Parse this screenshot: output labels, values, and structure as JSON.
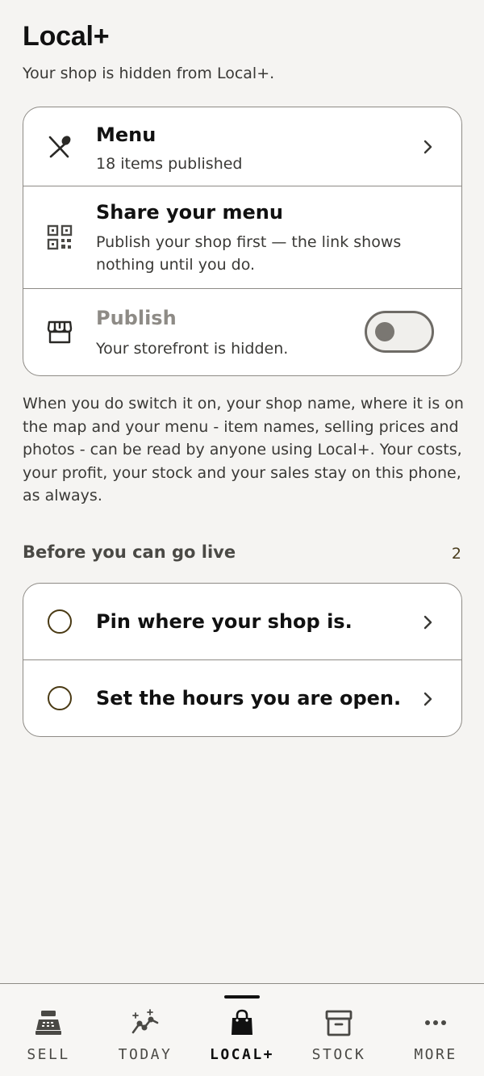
{
  "header": {
    "title": "Local+",
    "subtitle": "Your shop is hidden from Local+."
  },
  "settings": {
    "menu": {
      "title": "Menu",
      "subtitle": "18 items published",
      "icon": "utensils-icon"
    },
    "share": {
      "title": "Share your menu",
      "subtitle": "Publish your shop first — the link shows nothing until you do.",
      "icon": "qr-code-icon"
    },
    "publish": {
      "title": "Publish",
      "subtitle": "Your storefront is hidden.",
      "icon": "storefront-icon",
      "enabled": false
    }
  },
  "privacy_note": "When you do switch it on, your shop name, where it is on the map and your menu - item names, selling prices and photos - can be read by anyone using Local+. Your costs, your profit, your stock and your sales stay on this phone, as always.",
  "checklist": {
    "heading": "Before you can go live",
    "count": "2",
    "items": [
      {
        "label": "Pin where your shop is.",
        "done": false
      },
      {
        "label": "Set the hours you are open.",
        "done": false
      }
    ]
  },
  "tabbar": {
    "active": "LOCAL+",
    "tabs": [
      {
        "label": "SELL",
        "icon": "cash-register-icon"
      },
      {
        "label": "TODAY",
        "icon": "trend-sparkle-icon"
      },
      {
        "label": "LOCAL+",
        "icon": "shopping-bag-icon"
      },
      {
        "label": "STOCK",
        "icon": "archive-box-icon"
      },
      {
        "label": "MORE",
        "icon": "more-dots-icon"
      }
    ]
  },
  "colors": {
    "background": "#f5f4f2",
    "card": "#ffffff",
    "border": "#8e8b86",
    "ring": "#4a3a14"
  }
}
